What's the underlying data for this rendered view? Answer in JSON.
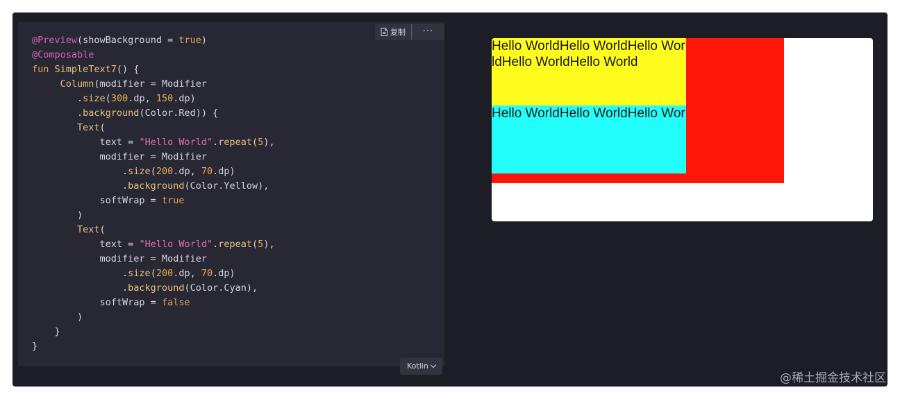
{
  "toolbar": {
    "copy_label": "复制",
    "more_label": "···",
    "copy_icon": "document-icon"
  },
  "language": {
    "label": "Kotlin"
  },
  "code_lines": [
    [
      {
        "t": "@Preview",
        "c": "tk-anno"
      },
      {
        "t": "(showBackground = ",
        "c": "tk-plain"
      },
      {
        "t": "true",
        "c": "tk-kw"
      },
      {
        "t": ")",
        "c": "tk-plain"
      }
    ],
    [
      {
        "t": "@Composable",
        "c": "tk-anno"
      }
    ],
    [
      {
        "t": "fun ",
        "c": "tk-kw"
      },
      {
        "t": "SimpleText7",
        "c": "tk-fn"
      },
      {
        "t": "() {",
        "c": "tk-plain"
      }
    ],
    [
      {
        "t": "     ",
        "c": "tk-plain"
      },
      {
        "t": "Column",
        "c": "tk-fn"
      },
      {
        "t": "(modifier = Modifier",
        "c": "tk-plain"
      }
    ],
    [
      {
        "t": "        .",
        "c": "tk-plain"
      },
      {
        "t": "size",
        "c": "tk-fn"
      },
      {
        "t": "(",
        "c": "tk-plain"
      },
      {
        "t": "300",
        "c": "tk-num"
      },
      {
        "t": ".dp, ",
        "c": "tk-plain"
      },
      {
        "t": "150",
        "c": "tk-num"
      },
      {
        "t": ".dp)",
        "c": "tk-plain"
      }
    ],
    [
      {
        "t": "        .",
        "c": "tk-plain"
      },
      {
        "t": "background",
        "c": "tk-fn"
      },
      {
        "t": "(Color.Red)) {",
        "c": "tk-plain"
      }
    ],
    [
      {
        "t": "        ",
        "c": "tk-plain"
      },
      {
        "t": "Text",
        "c": "tk-fn"
      },
      {
        "t": "(",
        "c": "tk-plain"
      }
    ],
    [
      {
        "t": "            text = ",
        "c": "tk-plain"
      },
      {
        "t": "\"Hello World\"",
        "c": "tk-str"
      },
      {
        "t": ".",
        "c": "tk-plain"
      },
      {
        "t": "repeat",
        "c": "tk-fn"
      },
      {
        "t": "(",
        "c": "tk-plain"
      },
      {
        "t": "5",
        "c": "tk-num"
      },
      {
        "t": "),",
        "c": "tk-plain"
      }
    ],
    [
      {
        "t": "            modifier = Modifier",
        "c": "tk-plain"
      }
    ],
    [
      {
        "t": "                .",
        "c": "tk-plain"
      },
      {
        "t": "size",
        "c": "tk-fn"
      },
      {
        "t": "(",
        "c": "tk-plain"
      },
      {
        "t": "200",
        "c": "tk-num"
      },
      {
        "t": ".dp, ",
        "c": "tk-plain"
      },
      {
        "t": "70",
        "c": "tk-num"
      },
      {
        "t": ".dp)",
        "c": "tk-plain"
      }
    ],
    [
      {
        "t": "                .",
        "c": "tk-plain"
      },
      {
        "t": "background",
        "c": "tk-fn"
      },
      {
        "t": "(Color.Yellow),",
        "c": "tk-plain"
      }
    ],
    [
      {
        "t": "            softWrap = ",
        "c": "tk-plain"
      },
      {
        "t": "true",
        "c": "tk-kw"
      }
    ],
    [
      {
        "t": "        )",
        "c": "tk-plain"
      }
    ],
    [
      {
        "t": "        ",
        "c": "tk-plain"
      },
      {
        "t": "Text",
        "c": "tk-fn"
      },
      {
        "t": "(",
        "c": "tk-plain"
      }
    ],
    [
      {
        "t": "            text = ",
        "c": "tk-plain"
      },
      {
        "t": "\"Hello World\"",
        "c": "tk-str"
      },
      {
        "t": ".",
        "c": "tk-plain"
      },
      {
        "t": "repeat",
        "c": "tk-fn"
      },
      {
        "t": "(",
        "c": "tk-plain"
      },
      {
        "t": "5",
        "c": "tk-num"
      },
      {
        "t": "),",
        "c": "tk-plain"
      }
    ],
    [
      {
        "t": "            modifier = Modifier",
        "c": "tk-plain"
      }
    ],
    [
      {
        "t": "                .",
        "c": "tk-plain"
      },
      {
        "t": "size",
        "c": "tk-fn"
      },
      {
        "t": "(",
        "c": "tk-plain"
      },
      {
        "t": "200",
        "c": "tk-num"
      },
      {
        "t": ".dp, ",
        "c": "tk-plain"
      },
      {
        "t": "70",
        "c": "tk-num"
      },
      {
        "t": ".dp)",
        "c": "tk-plain"
      }
    ],
    [
      {
        "t": "                .",
        "c": "tk-plain"
      },
      {
        "t": "background",
        "c": "tk-fn"
      },
      {
        "t": "(Color.Cyan),",
        "c": "tk-plain"
      }
    ],
    [
      {
        "t": "            softWrap = ",
        "c": "tk-plain"
      },
      {
        "t": "false",
        "c": "tk-kw"
      }
    ],
    [
      {
        "t": "        )",
        "c": "tk-plain"
      }
    ],
    [
      {
        "t": "    }",
        "c": "tk-plain"
      }
    ],
    [
      {
        "t": "}",
        "c": "tk-plain"
      }
    ]
  ],
  "preview": {
    "wrapped_text": "Hello WorldHello WorldHello WorldHello WorldHello World",
    "nowrap_text": "Hello WorldHello WorldHello WorldHello WorldHello World",
    "colors": {
      "column_bg": "#ff1608",
      "yellow": "#fffc1e",
      "cyan": "#22fffb"
    }
  },
  "watermark": "@稀土掘金技术社区"
}
